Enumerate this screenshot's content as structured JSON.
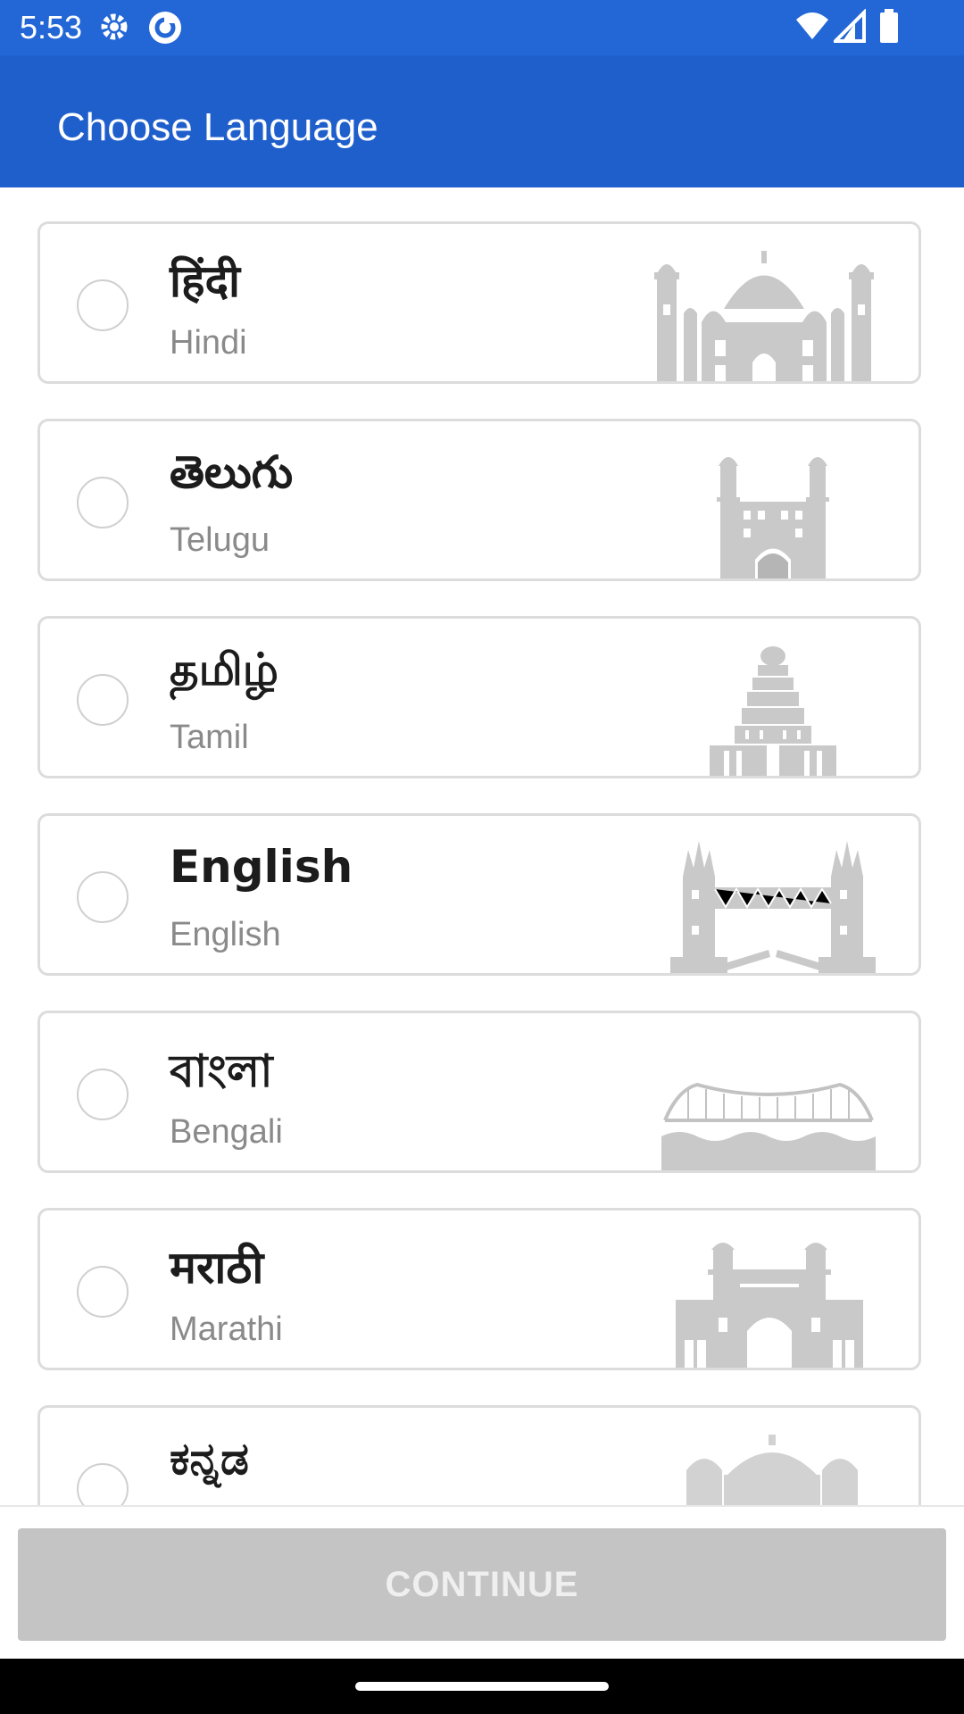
{
  "status_bar": {
    "time": "5:53",
    "icons": [
      "gear-icon",
      "sync-app-icon",
      "wifi-icon",
      "signal-icon",
      "battery-icon"
    ]
  },
  "app_bar": {
    "title": "Choose Language"
  },
  "languages": [
    {
      "native": "हिंदी",
      "english": "Hindi",
      "monument_icon": "taj-mahal-icon"
    },
    {
      "native": "తెలుగు",
      "english": "Telugu",
      "monument_icon": "charminar-icon"
    },
    {
      "native": "தமிழ்",
      "english": "Tamil",
      "monument_icon": "temple-gopuram-icon"
    },
    {
      "native": "English",
      "english": "English",
      "monument_icon": "tower-bridge-icon"
    },
    {
      "native": "বাংলা",
      "english": "Bengali",
      "monument_icon": "howrah-bridge-icon"
    },
    {
      "native": "मराठी",
      "english": "Marathi",
      "monument_icon": "gateway-of-india-icon"
    },
    {
      "native": "ಕನ್ನಡ",
      "english": "",
      "monument_icon": "gol-gumbaz-icon"
    }
  ],
  "footer": {
    "continue_label": "CONTINUE",
    "continue_enabled": false
  },
  "colors": {
    "status_bar": "#2367d6",
    "app_bar": "#1f5fcc",
    "disabled_button": "#c4c4c4",
    "monument_gray": "#c9c9c9"
  }
}
